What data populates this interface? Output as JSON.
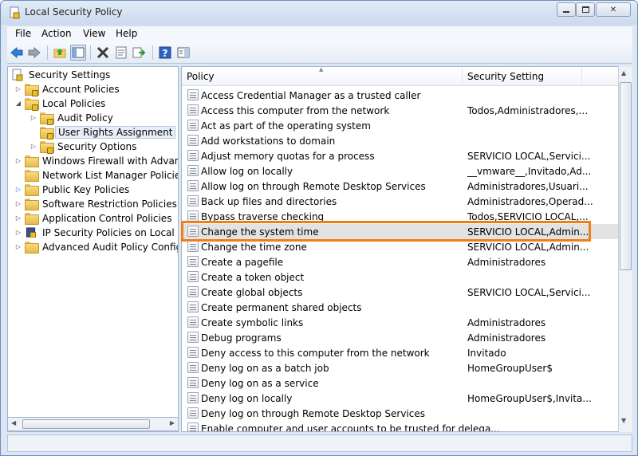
{
  "window": {
    "title": "Local Security Policy",
    "min": "▭",
    "max": "□",
    "close": "✕"
  },
  "menu": [
    "File",
    "Action",
    "View",
    "Help"
  ],
  "toolbar_icons": [
    "back-icon",
    "forward-icon",
    "up-folder-icon",
    "show-hide-tree-icon",
    "delete-icon",
    "properties-icon",
    "export-list-icon",
    "help-icon",
    "show-pane-icon"
  ],
  "tree": {
    "root": "Security Settings",
    "items": [
      {
        "label": "Account Policies",
        "indent": 1,
        "expander": "▷"
      },
      {
        "label": "Local Policies",
        "indent": 1,
        "expander": "◢"
      },
      {
        "label": "Audit Policy",
        "indent": 2,
        "expander": "▷"
      },
      {
        "label": "User Rights Assignment",
        "indent": 2,
        "expander": ""
      },
      {
        "label": "Security Options",
        "indent": 2,
        "expander": "▷"
      },
      {
        "label": "Windows Firewall with Advance",
        "indent": 1,
        "expander": "▷"
      },
      {
        "label": "Network List Manager Policies",
        "indent": 1,
        "expander": ""
      },
      {
        "label": "Public Key Policies",
        "indent": 1,
        "expander": "▷"
      },
      {
        "label": "Software Restriction Policies",
        "indent": 1,
        "expander": "▷"
      },
      {
        "label": "Application Control Policies",
        "indent": 1,
        "expander": "▷"
      },
      {
        "label": "IP Security Policies on Local Cor",
        "indent": 1,
        "expander": "▷"
      },
      {
        "label": "Advanced Audit Policy Configur",
        "indent": 1,
        "expander": "▷"
      }
    ]
  },
  "list": {
    "columns": [
      "Policy",
      "Security Setting"
    ],
    "rows": [
      {
        "policy": "Access Credential Manager as a trusted caller",
        "setting": ""
      },
      {
        "policy": "Access this computer from the network",
        "setting": "Todos,Administradores,..."
      },
      {
        "policy": "Act as part of the operating system",
        "setting": ""
      },
      {
        "policy": "Add workstations to domain",
        "setting": ""
      },
      {
        "policy": "Adjust memory quotas for a process",
        "setting": "SERVICIO LOCAL,Servici..."
      },
      {
        "policy": "Allow log on locally",
        "setting": "__vmware__,Invitado,Ad..."
      },
      {
        "policy": "Allow log on through Remote Desktop Services",
        "setting": "Administradores,Usuari..."
      },
      {
        "policy": "Back up files and directories",
        "setting": "Administradores,Operad..."
      },
      {
        "policy": "Bypass traverse checking",
        "setting": "Todos,SERVICIO LOCAL,..."
      },
      {
        "policy": "Change the system time",
        "setting": "SERVICIO LOCAL,Admin..."
      },
      {
        "policy": "Change the time zone",
        "setting": "SERVICIO LOCAL,Admin..."
      },
      {
        "policy": "Create a pagefile",
        "setting": "Administradores"
      },
      {
        "policy": "Create a token object",
        "setting": ""
      },
      {
        "policy": "Create global objects",
        "setting": "SERVICIO LOCAL,Servici..."
      },
      {
        "policy": "Create permanent shared objects",
        "setting": ""
      },
      {
        "policy": "Create symbolic links",
        "setting": "Administradores"
      },
      {
        "policy": "Debug programs",
        "setting": "Administradores"
      },
      {
        "policy": "Deny access to this computer from the network",
        "setting": "Invitado"
      },
      {
        "policy": "Deny log on as a batch job",
        "setting": "HomeGroupUser$"
      },
      {
        "policy": "Deny log on as a service",
        "setting": ""
      },
      {
        "policy": "Deny log on locally",
        "setting": "HomeGroupUser$,Invita..."
      },
      {
        "policy": "Deny log on through Remote Desktop Services",
        "setting": ""
      },
      {
        "policy": "Enable computer and user accounts to be trusted for delega...",
        "setting": ""
      }
    ]
  },
  "highlight_color": "#f07d1a"
}
